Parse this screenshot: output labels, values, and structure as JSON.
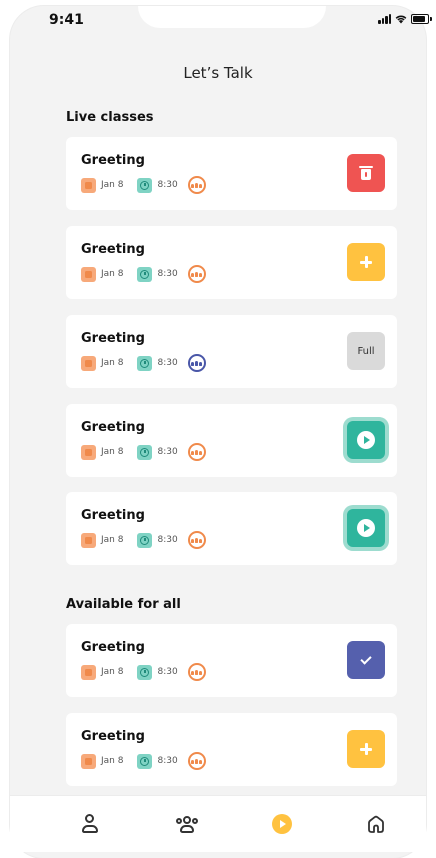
{
  "status_bar": {
    "time": "9:41"
  },
  "header": {
    "title": "Let’s Talk"
  },
  "sections": {
    "live": {
      "title": "Live classes"
    },
    "available": {
      "title": "Available for all"
    }
  },
  "cards": [
    {
      "title": "Greeting",
      "date": "Jan 8",
      "time": "8:30",
      "action": "delete",
      "group_color": "#f08a4b"
    },
    {
      "title": "Greeting",
      "date": "Jan 8",
      "time": "8:30",
      "action": "add",
      "group_color": "#f08a4b"
    },
    {
      "title": "Greeting",
      "date": "Jan 8",
      "time": "8:30",
      "action": "full",
      "action_label": "Full",
      "group_color": "#4a57a8"
    },
    {
      "title": "Greeting",
      "date": "Jan 8",
      "time": "8:30",
      "action": "play",
      "group_color": "#f08a4b"
    },
    {
      "title": "Greeting",
      "date": "Jan 8",
      "time": "8:30",
      "action": "play",
      "group_color": "#f08a4b"
    },
    {
      "title": "Greeting",
      "date": "Jan 8",
      "time": "8:30",
      "action": "check",
      "group_color": "#f08a4b"
    },
    {
      "title": "Greeting",
      "date": "Jan 8",
      "time": "8:30",
      "action": "add",
      "group_color": "#f08a4b"
    }
  ],
  "tabbar": {
    "items": [
      {
        "icon": "person-icon"
      },
      {
        "icon": "group-icon"
      },
      {
        "icon": "play-icon",
        "active": true
      },
      {
        "icon": "home-icon"
      }
    ]
  },
  "colors": {
    "delete": "#ef5452",
    "add": "#ffc240",
    "full": "#dadada",
    "play": "#2fb59d",
    "check": "#5560ad",
    "background": "#f3f3f3"
  }
}
